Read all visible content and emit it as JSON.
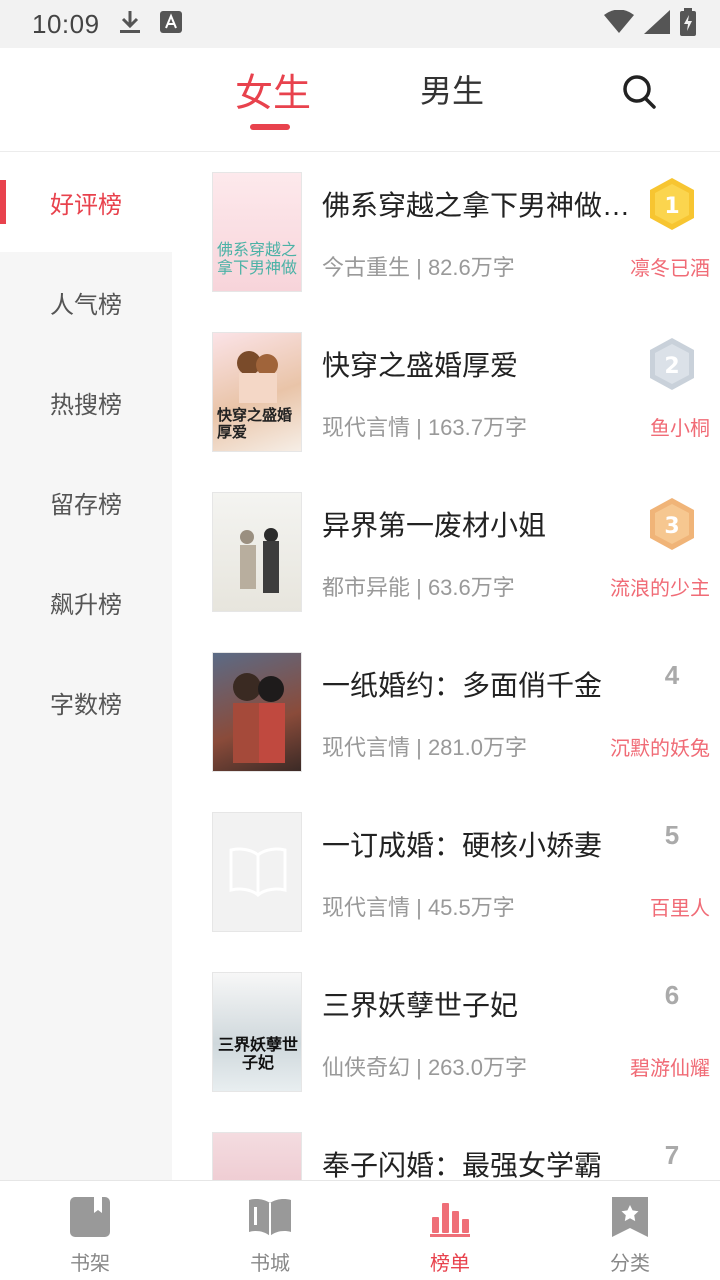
{
  "status_bar": {
    "time": "10:09"
  },
  "top_tabs": {
    "female": "女生",
    "male": "男生"
  },
  "sidebar": {
    "items": [
      {
        "label": "好评榜"
      },
      {
        "label": "人气榜"
      },
      {
        "label": "热搜榜"
      },
      {
        "label": "留存榜"
      },
      {
        "label": "飙升榜"
      },
      {
        "label": "字数榜"
      }
    ]
  },
  "books": [
    {
      "rank": "1",
      "title": "佛系穿越之拿下男神做老公",
      "meta": "今古重生 | 82.6万字",
      "author": "凛冬已酒",
      "cover_text": "佛系穿越之拿下男神做",
      "medal": "gold"
    },
    {
      "rank": "2",
      "title": "快穿之盛婚厚爱",
      "meta": "现代言情 | 163.7万字",
      "author": "鱼小桐",
      "cover_text": "快穿之盛婚厚爱",
      "medal": "silver"
    },
    {
      "rank": "3",
      "title": "异界第一废材小姐",
      "meta": "都市异能 | 63.6万字",
      "author": "流浪的少主",
      "cover_text": "",
      "medal": "bronze"
    },
    {
      "rank": "4",
      "title": "一纸婚约：多面俏千金",
      "meta": "现代言情 | 281.0万字",
      "author": "沉默的妖兔",
      "cover_text": "",
      "medal": ""
    },
    {
      "rank": "5",
      "title": "一订成婚：硬核小娇妻",
      "meta": "现代言情 | 45.5万字",
      "author": "百里人",
      "cover_text": "",
      "medal": ""
    },
    {
      "rank": "6",
      "title": "三界妖孽世子妃",
      "meta": "仙侠奇幻 | 263.0万字",
      "author": "碧游仙耀",
      "cover_text": "三界妖孽世子妃",
      "medal": ""
    },
    {
      "rank": "7",
      "title": "奉子闪婚：最强女学霸",
      "meta": "",
      "author": "",
      "cover_text": "",
      "medal": ""
    }
  ],
  "bottom_nav": {
    "items": [
      {
        "label": "书架",
        "icon": "bookmark-book-icon"
      },
      {
        "label": "书城",
        "icon": "open-book-icon"
      },
      {
        "label": "榜单",
        "icon": "bar-chart-icon"
      },
      {
        "label": "分类",
        "icon": "star-bookmark-icon"
      }
    ]
  },
  "colors": {
    "accent": "#e8424d",
    "author": "#f06b76",
    "gold": "#f7c531",
    "silver": "#c9d1da",
    "bronze": "#f0b478"
  }
}
